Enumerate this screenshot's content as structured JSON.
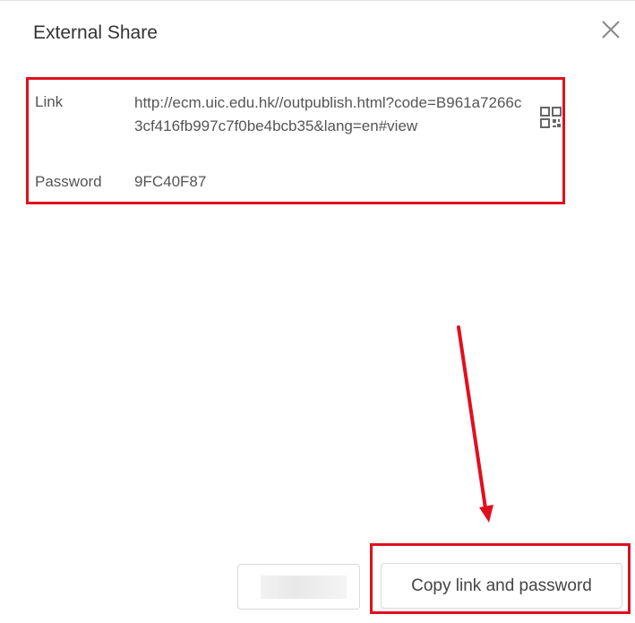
{
  "dialog": {
    "title": "External Share",
    "close_icon": "close-icon"
  },
  "share_info": {
    "link_label": "Link",
    "link_value": "http://ecm.uic.edu.hk//outpublish.html?code=B961a7266c3cf416fb997c7f0be4bcb35&lang=en#view",
    "qr_icon": "qr-code-icon",
    "password_label": "Password",
    "password_value": "9FC40F87"
  },
  "footer": {
    "secondary_label": "S",
    "primary_label": "Copy link and password"
  },
  "annotations": {
    "highlight_color": "#e0101e"
  }
}
